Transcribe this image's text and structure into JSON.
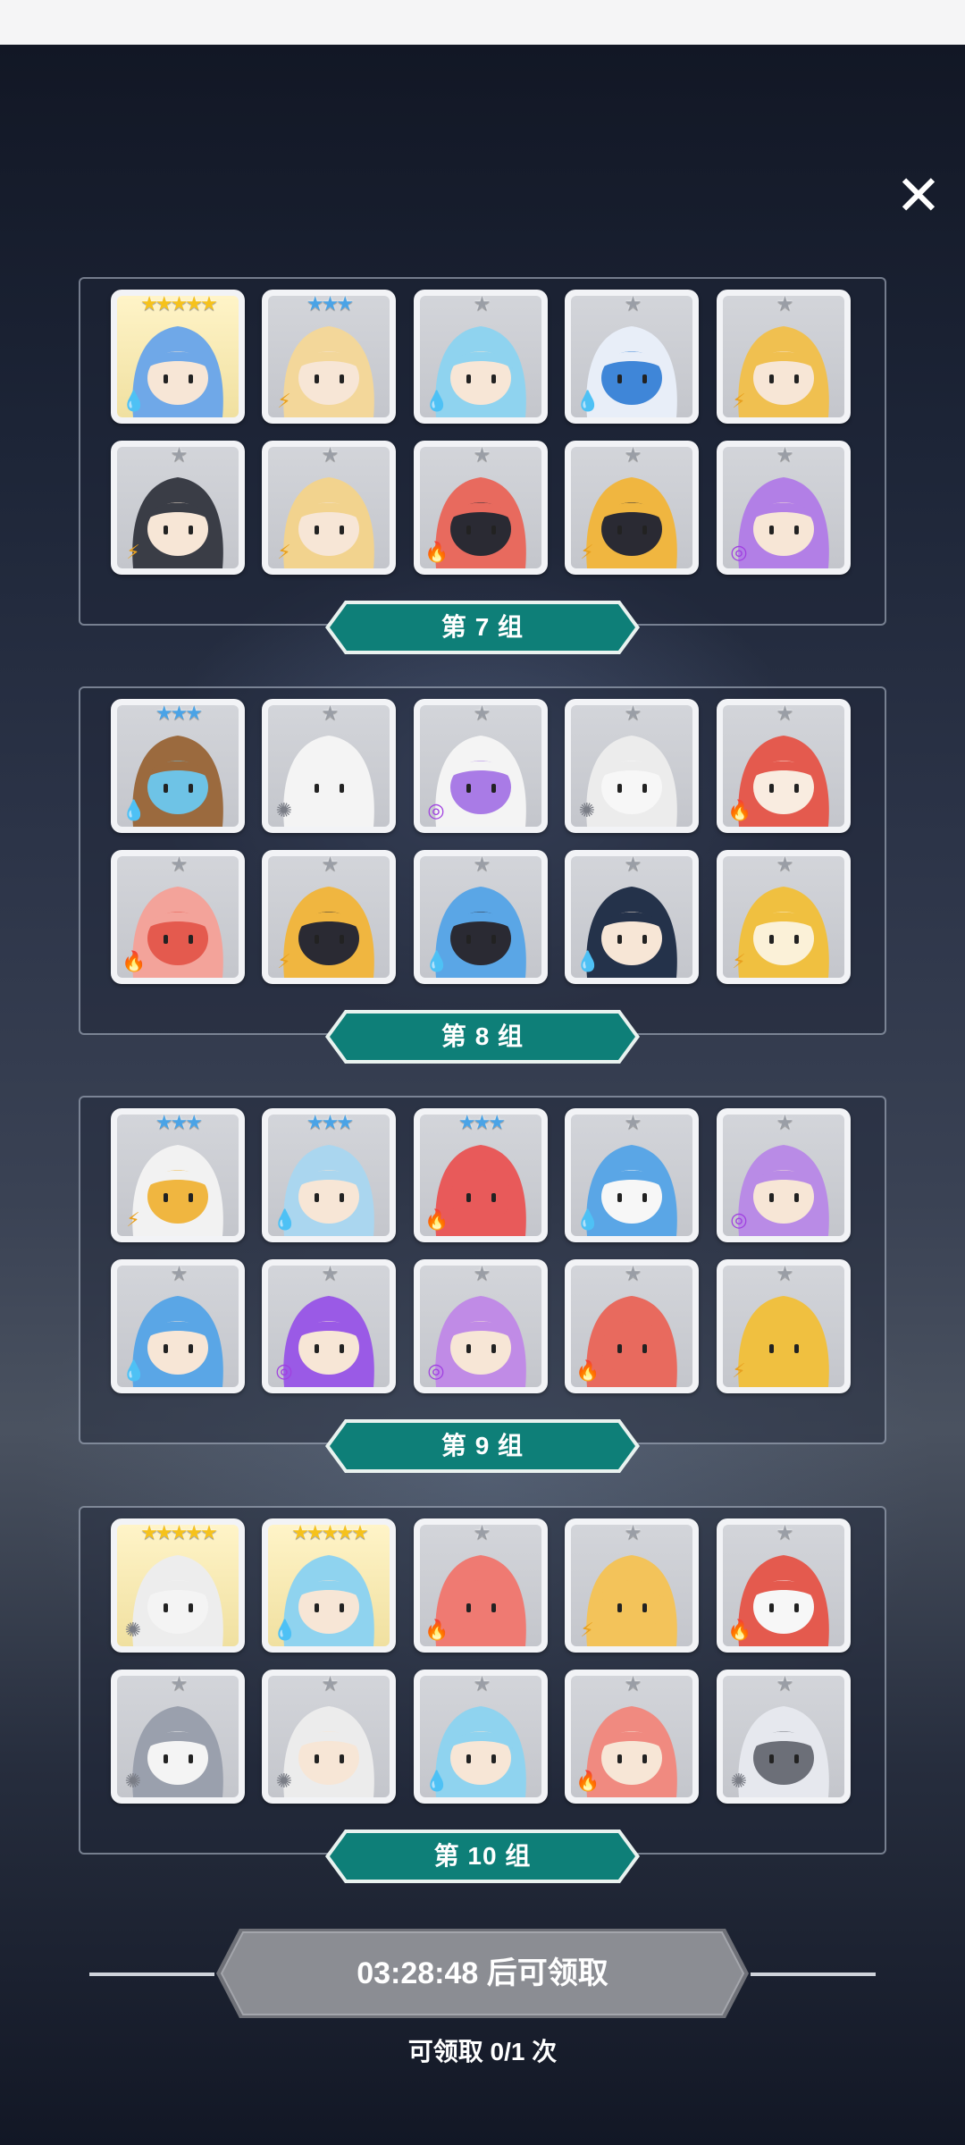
{
  "close": {
    "icon": "close-icon",
    "glyph": "✕"
  },
  "groups": [
    {
      "label": "第 7 组",
      "heroes": [
        {
          "stars": "★★★★★",
          "star_color": "#f6c21b",
          "gold": true,
          "element": "water",
          "hair": "#6fa8e8",
          "face": "#f7e6d6"
        },
        {
          "stars": "★★★",
          "star_color": "#4aa3e6",
          "gold": false,
          "element": "thunder",
          "hair": "#f3d79a",
          "face": "#f7e6d6"
        },
        {
          "stars": "★",
          "star_color": "#9a9ea6",
          "gold": false,
          "element": "water",
          "hair": "#8fd3ef",
          "face": "#f7e6d6"
        },
        {
          "stars": "★",
          "star_color": "#9a9ea6",
          "gold": false,
          "element": "water",
          "hair": "#e8eef8",
          "face": "#3f86d8"
        },
        {
          "stars": "★",
          "star_color": "#9a9ea6",
          "gold": false,
          "element": "thunder",
          "hair": "#f0c050",
          "face": "#f7e6d6"
        },
        {
          "stars": "★",
          "star_color": "#9a9ea6",
          "gold": false,
          "element": "thunder",
          "hair": "#3a3d46",
          "face": "#f7e6d6"
        },
        {
          "stars": "★",
          "star_color": "#9a9ea6",
          "gold": false,
          "element": "thunder",
          "hair": "#f2d38e",
          "face": "#f7e6d6"
        },
        {
          "stars": "★",
          "star_color": "#9a9ea6",
          "gold": false,
          "element": "fire",
          "hair": "#e86a5e",
          "face": "#2a2a33"
        },
        {
          "stars": "★",
          "star_color": "#9a9ea6",
          "gold": false,
          "element": "thunder",
          "hair": "#f0b640",
          "face": "#2a2a33"
        },
        {
          "stars": "★",
          "star_color": "#9a9ea6",
          "gold": false,
          "element": "dark",
          "hair": "#b27fe6",
          "face": "#f7e6d6"
        }
      ]
    },
    {
      "label": "第 8 组",
      "heroes": [
        {
          "stars": "★★★",
          "star_color": "#4aa3e6",
          "gold": false,
          "element": "water",
          "hair": "#9b6a3e",
          "face": "#6ec3e6"
        },
        {
          "stars": "★",
          "star_color": "#9a9ea6",
          "gold": false,
          "element": "light",
          "hair": "#f4f4f4",
          "face": "#f4f4f4"
        },
        {
          "stars": "★",
          "star_color": "#9a9ea6",
          "gold": false,
          "element": "dark",
          "hair": "#f4f4f4",
          "face": "#a97be6"
        },
        {
          "stars": "★",
          "star_color": "#9a9ea6",
          "gold": false,
          "element": "light",
          "hair": "#ececec",
          "face": "#f7f7f7"
        },
        {
          "stars": "★",
          "star_color": "#9a9ea6",
          "gold": false,
          "element": "fire",
          "hair": "#e45a4e",
          "face": "#f9ece0"
        },
        {
          "stars": "★",
          "star_color": "#9a9ea6",
          "gold": false,
          "element": "fire",
          "hair": "#f3a39a",
          "face": "#e45a4e"
        },
        {
          "stars": "★",
          "star_color": "#9a9ea6",
          "gold": false,
          "element": "thunder",
          "hair": "#f0b640",
          "face": "#2a2a33"
        },
        {
          "stars": "★",
          "star_color": "#9a9ea6",
          "gold": false,
          "element": "water",
          "hair": "#5aa6e6",
          "face": "#2a2a33"
        },
        {
          "stars": "★",
          "star_color": "#9a9ea6",
          "gold": false,
          "element": "water",
          "hair": "#24324a",
          "face": "#f7e6d6"
        },
        {
          "stars": "★",
          "star_color": "#9a9ea6",
          "gold": false,
          "element": "thunder",
          "hair": "#f0c040",
          "face": "#fbf1d8"
        }
      ]
    },
    {
      "label": "第 9 组",
      "heroes": [
        {
          "stars": "★★★",
          "star_color": "#4aa3e6",
          "gold": false,
          "element": "thunder",
          "hair": "#f2f2f2",
          "face": "#f0b640"
        },
        {
          "stars": "★★★",
          "star_color": "#4aa3e6",
          "gold": false,
          "element": "water",
          "hair": "#aad6ef",
          "face": "#f7e6d6"
        },
        {
          "stars": "★★★",
          "star_color": "#4aa3e6",
          "gold": false,
          "element": "fire",
          "hair": "#e85a5a",
          "face": "#e85a5a"
        },
        {
          "stars": "★",
          "star_color": "#9a9ea6",
          "gold": false,
          "element": "water",
          "hair": "#5aa6e6",
          "face": "#f7f7f7"
        },
        {
          "stars": "★",
          "star_color": "#9a9ea6",
          "gold": false,
          "element": "dark",
          "hair": "#b98be6",
          "face": "#f7e6d6"
        },
        {
          "stars": "★",
          "star_color": "#9a9ea6",
          "gold": false,
          "element": "water",
          "hair": "#5aa6e6",
          "face": "#f7e6d6"
        },
        {
          "stars": "★",
          "star_color": "#9a9ea6",
          "gold": false,
          "element": "dark",
          "hair": "#9a5ae6",
          "face": "#f7e6d6"
        },
        {
          "stars": "★",
          "star_color": "#9a9ea6",
          "gold": false,
          "element": "dark",
          "hair": "#c08be6",
          "face": "#f7e6d6"
        },
        {
          "stars": "★",
          "star_color": "#9a9ea6",
          "gold": false,
          "element": "fire",
          "hair": "#e86a5e",
          "face": "#e86a5e"
        },
        {
          "stars": "★",
          "star_color": "#9a9ea6",
          "gold": false,
          "element": "thunder",
          "hair": "#f0c040",
          "face": "#f0c040"
        }
      ]
    },
    {
      "label": "第 10 组",
      "heroes": [
        {
          "stars": "★★★★★",
          "star_color": "#f6c21b",
          "gold": true,
          "element": "light",
          "hair": "#ededed",
          "face": "#f4f4f4"
        },
        {
          "stars": "★★★★★",
          "star_color": "#f6c21b",
          "gold": true,
          "element": "water",
          "hair": "#8fd3ef",
          "face": "#f7e6d6"
        },
        {
          "stars": "★",
          "star_color": "#9a9ea6",
          "gold": false,
          "element": "fire",
          "hair": "#ef7a72",
          "face": "#ef7a72"
        },
        {
          "stars": "★",
          "star_color": "#9a9ea6",
          "gold": false,
          "element": "thunder",
          "hair": "#f3c35a",
          "face": "#f3c35a"
        },
        {
          "stars": "★",
          "star_color": "#9a9ea6",
          "gold": false,
          "element": "fire",
          "hair": "#e45a4e",
          "face": "#f7f7f7"
        },
        {
          "stars": "★",
          "star_color": "#9a9ea6",
          "gold": false,
          "element": "light",
          "hair": "#9aa0ad",
          "face": "#f4f4f4"
        },
        {
          "stars": "★",
          "star_color": "#9a9ea6",
          "gold": false,
          "element": "light",
          "hair": "#ececec",
          "face": "#f7e6d6"
        },
        {
          "stars": "★",
          "star_color": "#9a9ea6",
          "gold": false,
          "element": "water",
          "hair": "#8fd3ef",
          "face": "#f7e6d6"
        },
        {
          "stars": "★",
          "star_color": "#9a9ea6",
          "gold": false,
          "element": "fire",
          "hair": "#f08a80",
          "face": "#f7e6d6"
        },
        {
          "stars": "★",
          "star_color": "#9a9ea6",
          "gold": false,
          "element": "light",
          "hair": "#e6e8ee",
          "face": "#6c6f78"
        }
      ]
    }
  ],
  "elements": {
    "water": {
      "glyph": "💧",
      "color": "#2f7fd8"
    },
    "thunder": {
      "glyph": "⚡",
      "color": "#e8a020"
    },
    "fire": {
      "glyph": "🔥",
      "color": "#d8382c"
    },
    "dark": {
      "glyph": "◎",
      "color": "#a040e0"
    },
    "light": {
      "glyph": "✺",
      "color": "#7a7d86"
    }
  },
  "claim": {
    "button_label": "03:28:48 后可领取",
    "count_label": "可领取 0/1 次"
  },
  "colors": {
    "banner": "#0e7f78",
    "claim_button": "#8b8d93"
  }
}
